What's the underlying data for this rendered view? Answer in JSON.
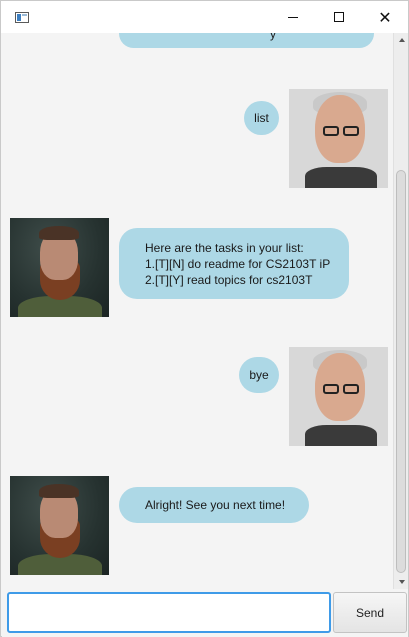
{
  "window": {
    "title": "",
    "minimize_glyph": "",
    "close_glyph": "✕"
  },
  "dialog": {
    "partial_top_text": "y",
    "messages": [
      {
        "sender": "user",
        "text": "list"
      },
      {
        "sender": "duke",
        "text": "Here are the tasks in your list:\n1.[T][N] do readme for CS2103T iP\n2.[T][Y] read topics for cs2103T"
      },
      {
        "sender": "user",
        "text": "bye"
      },
      {
        "sender": "duke",
        "text": "Alright! See you next time!"
      }
    ]
  },
  "input": {
    "value": "",
    "placeholder": ""
  },
  "send_button": {
    "label": "Send"
  },
  "colors": {
    "bubble": "#add8e6",
    "focus_border": "#3f9be8",
    "background": "#f4f4f4"
  },
  "icons": [
    "app-icon",
    "minimize-icon",
    "maximize-icon",
    "close-icon",
    "scroll-up-arrow-icon",
    "scroll-down-arrow-icon"
  ]
}
